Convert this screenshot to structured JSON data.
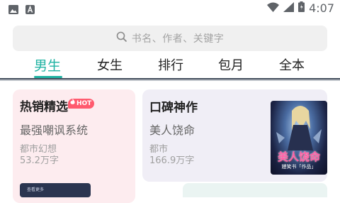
{
  "status_bar": {
    "time": "4:07",
    "icons": [
      "image-icon",
      "app-a-icon",
      "wifi-icon",
      "signal-icon",
      "battery-icon"
    ]
  },
  "search": {
    "placeholder": "书名、作者、关键字"
  },
  "tabs": [
    {
      "label": "男生",
      "active": true
    },
    {
      "label": "女生"
    },
    {
      "label": "排行"
    },
    {
      "label": "包月"
    },
    {
      "label": "全本"
    }
  ],
  "cards": [
    {
      "title": "热销精选",
      "badge": "HOT",
      "book": "最强嘲讽系统",
      "genre": "都市幻想",
      "word_count": "53.2万字",
      "bg": "#fdecef"
    },
    {
      "title": "口碑神作",
      "book": "美人饶命",
      "genre": "都市",
      "word_count": "166.9万字",
      "cover_title": "美人饶命",
      "cover_author": "嫚笑书「作品」",
      "bg": "#f0eef6"
    }
  ],
  "peek": {
    "label": "查看更多"
  },
  "colors": {
    "accent": "#21b3a3",
    "hot": "#ff5a6e"
  }
}
